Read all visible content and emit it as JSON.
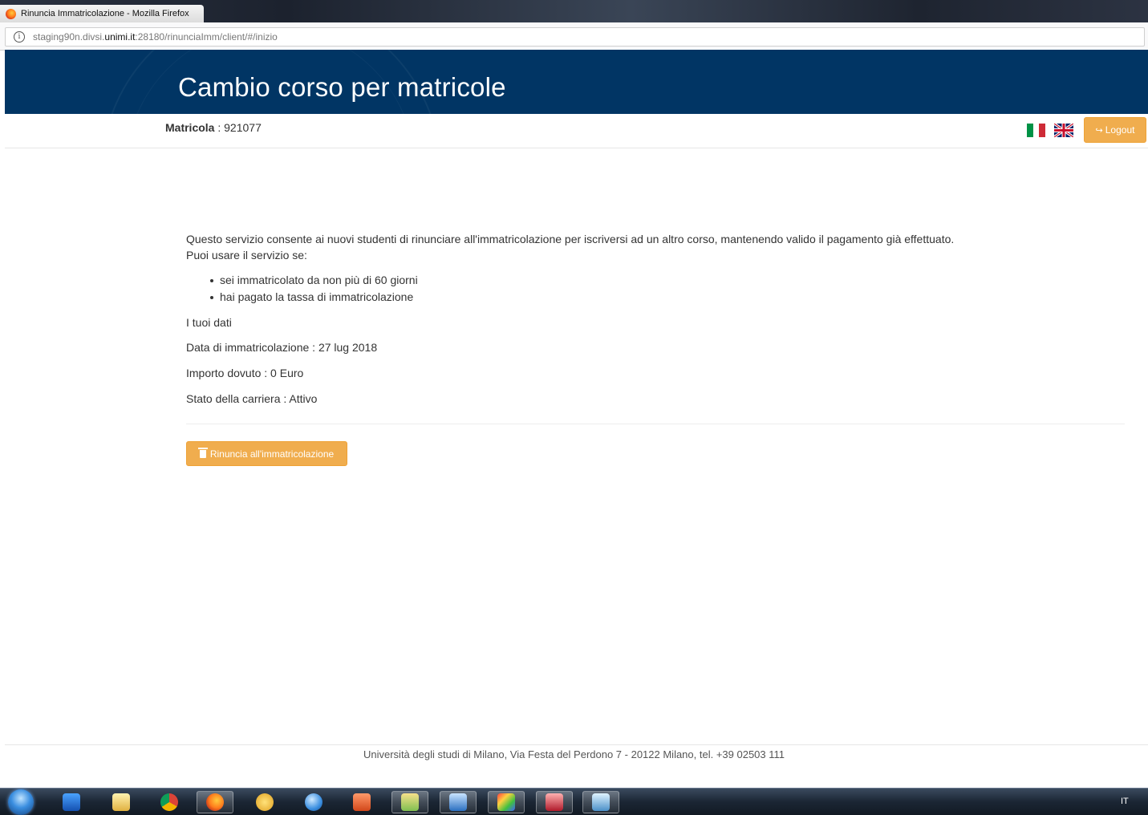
{
  "browser": {
    "tab_title": "Rinuncia Immatricolazione - Mozilla Firefox",
    "url_pre": "staging90n.divsi.",
    "url_domain": "unimi.it",
    "url_post": ":28180/rinunciaImm/client/#/inizio"
  },
  "header": {
    "title": "Cambio corso per matricole"
  },
  "subheader": {
    "matricola_label": "Matricola",
    "matricola_sep": " : ",
    "matricola_value": "921077",
    "logout_label": "Logout"
  },
  "content": {
    "intro_line1": "Questo servizio consente ai nuovi studenti di rinunciare all'immatricolazione per iscriversi ad un altro corso, mantenendo valido il pagamento già effettuato.",
    "intro_line2": "Puoi usare il servizio se:",
    "conditions": [
      "sei immatricolato da non più di 60 giorni",
      "hai pagato la tassa di immatricolazione"
    ],
    "dati_heading": "I tuoi dati",
    "data_immatricolazione": "Data di immatricolazione : 27 lug 2018",
    "importo_dovuto": "Importo dovuto : 0 Euro",
    "stato_carriera": "Stato della carriera : Attivo",
    "rinuncia_button": "Rinuncia all'immatricolazione"
  },
  "footer": {
    "text": "Università degli studi di Milano, Via Festa del Perdono 7 - 20122 Milano, tel. +39 02503 111"
  },
  "taskbar": {
    "language": "IT"
  },
  "colors": {
    "banner": "#013564",
    "button_warning": "#f0ad4e"
  }
}
